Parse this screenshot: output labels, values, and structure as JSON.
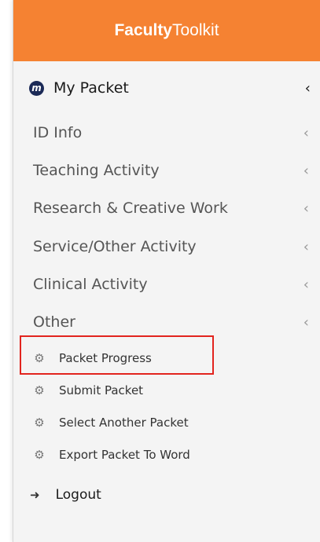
{
  "header": {
    "brand_bold": "Faculty",
    "brand_light": "Toolkit"
  },
  "my_packet": {
    "label": "My Packet",
    "icon_letter": "m"
  },
  "sections": [
    {
      "label": "ID Info"
    },
    {
      "label": "Teaching Activity"
    },
    {
      "label": "Research & Creative Work"
    },
    {
      "label": "Service/Other Activity"
    },
    {
      "label": "Clinical Activity"
    },
    {
      "label": "Other"
    }
  ],
  "sub_items": [
    {
      "label": "Packet Progress"
    },
    {
      "label": "Submit Packet"
    },
    {
      "label": "Select Another Packet"
    },
    {
      "label": "Export Packet To Word"
    }
  ],
  "logout": {
    "label": "Logout"
  },
  "colors": {
    "header_bg": "#f58232",
    "highlight": "#e2241e",
    "icon_bg": "#1b2a57"
  },
  "icons": {
    "expand": "chevron-left-icon",
    "sub": "gear-icon",
    "logout": "sign-out-icon"
  }
}
